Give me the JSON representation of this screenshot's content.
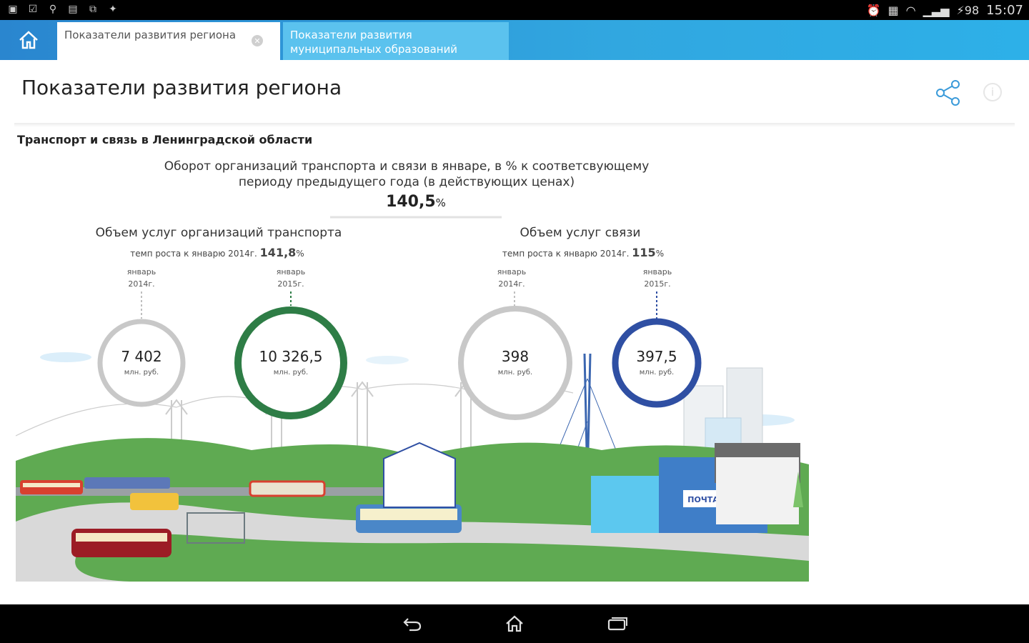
{
  "status_bar": {
    "time": "15:07",
    "battery": "98",
    "left_icons": [
      "notification-icon",
      "checkbox-icon",
      "usb-icon",
      "storage-icon",
      "screenshot-icon",
      "android-icon"
    ]
  },
  "tabs": [
    {
      "label": "Показатели развития региона",
      "active": true
    },
    {
      "label": "Показатели развития муниципальных образований",
      "active": false
    }
  ],
  "page": {
    "title": "Показатели развития региона",
    "section_title": "Транспорт и связь в Ленинградской области"
  },
  "infographic": {
    "headline": [
      "Оборот организаций транспорта и связи в январе, в % к соответсвующему",
      "периоду предыдущего года (в действующих ценах)"
    ],
    "headline_value": "140,5",
    "headline_unit": "%",
    "groups": [
      {
        "title": "Объем услуг организаций транспорта",
        "growth_label": "темп роста к январю 2014г.",
        "growth_value": "141,8",
        "growth_unit": "%",
        "items": [
          {
            "period": [
              "январь",
              "2014г."
            ],
            "value": "7 402",
            "unit": "млн. руб."
          },
          {
            "period": [
              "январь",
              "2015г."
            ],
            "value": "10 326,5",
            "unit": "млн. руб."
          }
        ]
      },
      {
        "title": "Объем услуг связи",
        "growth_label": "темп роста к январю 2014г.",
        "growth_value": "115",
        "growth_unit": "%",
        "items": [
          {
            "period": [
              "январь",
              "2014г."
            ],
            "value": "398",
            "unit": "млн. руб."
          },
          {
            "period": [
              "январь",
              "2015г."
            ],
            "value": "397,5",
            "unit": "млн. руб."
          }
        ]
      }
    ],
    "sign": "ПОЧТА"
  },
  "colors": {
    "tab_bar": "#2a86cf",
    "green_ring": "#2e7d46",
    "blue_ring": "#2f4fa3",
    "grey_ring": "#c8c8c8",
    "grass": "#5faa52"
  }
}
